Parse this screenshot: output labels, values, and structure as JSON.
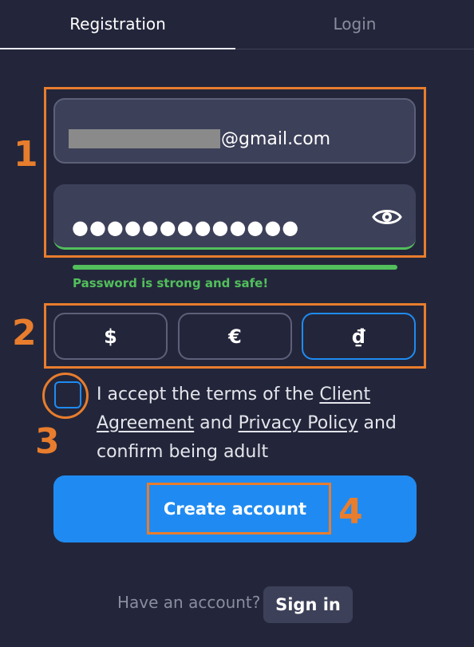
{
  "tabs": {
    "registration": "Registration",
    "login": "Login"
  },
  "form": {
    "email_suffix": "@gmail.com",
    "password_mask": "●●●●●●●●●●●●●",
    "strength_text": "Password is strong and safe!"
  },
  "currencies": [
    "$",
    "€",
    "₫"
  ],
  "selected_currency": "₫",
  "terms": {
    "prefix": "I accept the terms of the ",
    "client_agreement": "Client Agreement",
    "and1": " and ",
    "privacy_policy": "Privacy Policy",
    "suffix": " and confirm being adult"
  },
  "create_account_label": "Create account",
  "footer": {
    "have_account": "Have an account?",
    "sign_in": "Sign in"
  },
  "annotations": [
    "1",
    "2",
    "3",
    "4"
  ],
  "colors": {
    "background": "#23263a",
    "field": "#3d4059",
    "accent_blue": "#1f8bf2",
    "success_green": "#52bf5c",
    "annotation_orange": "#e87d2d"
  },
  "icons": {
    "password_toggle": "eye-icon"
  }
}
